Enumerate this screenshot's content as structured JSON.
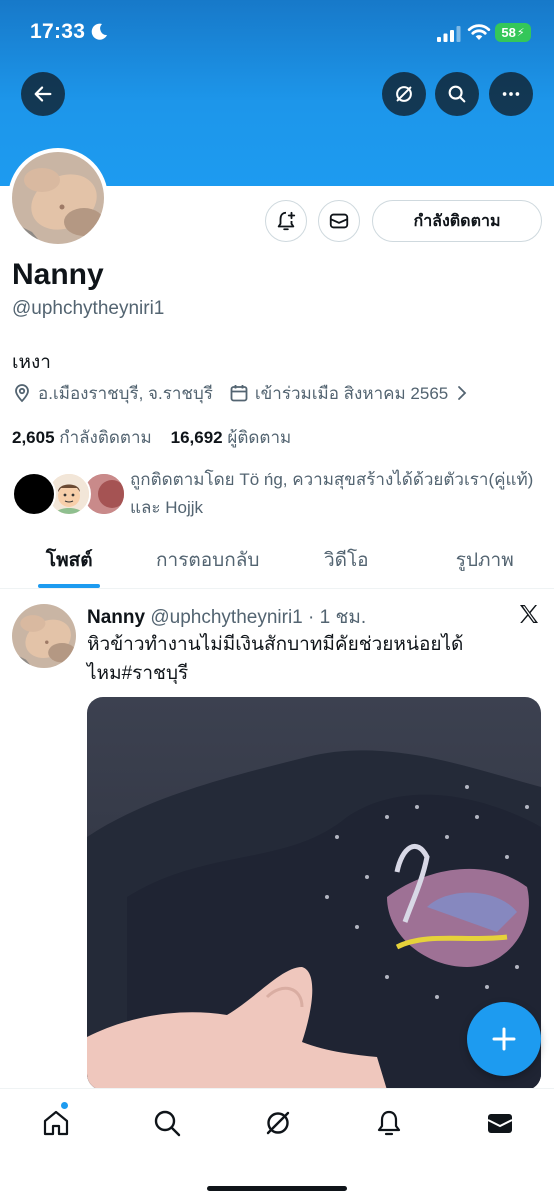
{
  "status_bar": {
    "time": "17:33",
    "battery": "58",
    "icons": [
      "moon-icon",
      "signal-icon",
      "wifi-icon",
      "battery-icon"
    ]
  },
  "header": {
    "buttons": [
      "back-arrow-icon",
      "grok-icon",
      "search-icon",
      "more-icon"
    ]
  },
  "profile": {
    "display_name": "Nanny",
    "handle": "@uphchytheyniri1",
    "bio": "เหงา",
    "location": "อ.เมืองราชบุรี, จ.ราชบุรี",
    "joined": "เข้าร่วมเมือ สิงหาคม 2565",
    "following_count": "2,605",
    "following_label": "กำลังติดตาม",
    "followers_count": "16,692",
    "followers_label": "ผู้ติดตาม",
    "followed_by": "ถูกติดตามโดย Tö ńg, ความสุขสร้างได้ด้วยตัวเรา(คู่แท้) และ Hojjk",
    "follow_button": "กำลังติดตาม"
  },
  "tabs": [
    {
      "label": "โพสต์",
      "active": true
    },
    {
      "label": "การตอบกลับ",
      "active": false
    },
    {
      "label": "วิดีโอ",
      "active": false
    },
    {
      "label": "รูปภาพ",
      "active": false
    }
  ],
  "tweet": {
    "name": "Nanny",
    "meta": "@uphchytheyniri1 · 1 ชม.",
    "text": "หิวข้าวทำงานไม่มีเงินสักบาทมีคัยช่วยหน่อยได้ไหม#ราชบุรี"
  },
  "bottom_nav": [
    "home-icon",
    "search-icon",
    "grok-icon",
    "bell-icon",
    "mail-icon"
  ],
  "colors": {
    "accent": "#1d9bf0",
    "text_primary": "#0f1419",
    "text_secondary": "#536471",
    "banner": "#1d9bf0"
  }
}
